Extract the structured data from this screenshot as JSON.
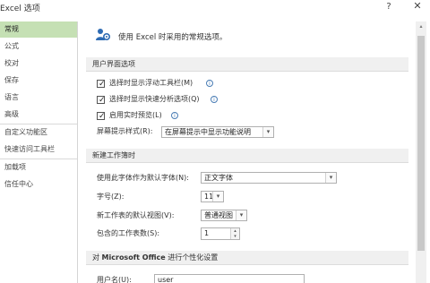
{
  "window": {
    "title": "Excel 选项",
    "help": "?",
    "close": "✕"
  },
  "nav": {
    "items": [
      {
        "label": "常规",
        "active": true
      },
      {
        "label": "公式"
      },
      {
        "label": "校对"
      },
      {
        "label": "保存"
      },
      {
        "label": "语言"
      },
      {
        "label": "高级"
      },
      {
        "label": "自定义功能区"
      },
      {
        "label": "快速访问工具栏"
      },
      {
        "label": "加载项"
      },
      {
        "label": "信任中心"
      }
    ]
  },
  "intro": {
    "text": "使用 Excel 时采用的常规选项。",
    "icon": "people-settings-icon"
  },
  "ui_section": {
    "title": "用户界面选项",
    "opt1": "选择时显示浮动工具栏(M)",
    "opt2": "选择时显示快速分析选项(Q)",
    "opt3": "启用实时预览(L)",
    "tip_label": "屏幕提示样式(R):",
    "tip_value": "在屏幕提示中显示功能说明"
  },
  "wb_section": {
    "title": "新建工作簿时",
    "font_label": "使用此字体作为默认字体(N):",
    "font_value": "正文字体",
    "size_label": "字号(Z):",
    "size_value": "11",
    "view_label": "新工作表的默认视图(V):",
    "view_value": "普通视图",
    "sheets_label": "包含的工作表数(S):",
    "sheets_value": "1"
  },
  "personal_section": {
    "title_prefix": "对",
    "title_bold": "Microsoft Office",
    "title_suffix": "进行个性化设置",
    "user_label": "用户名(U):",
    "user_value": "user"
  },
  "icons": {
    "check": "✓",
    "info": "i",
    "arrow_down": "▾",
    "arrow_up": "▴"
  }
}
